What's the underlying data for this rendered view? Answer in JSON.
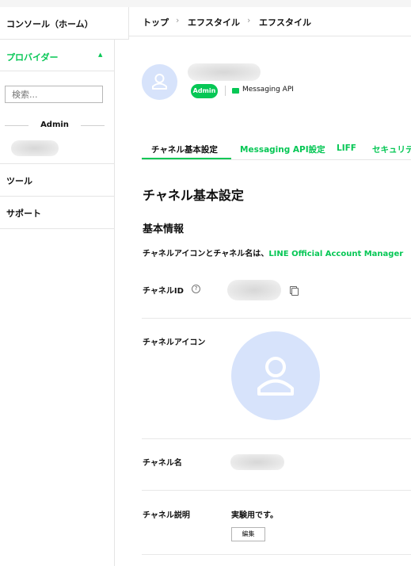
{
  "sidebar": {
    "home_label": "コンソール（ホーム）",
    "provider_label": "プロバイダー",
    "search_placeholder": "検索...",
    "admin_heading": "Admin",
    "items": [
      {
        "label": "ツール"
      },
      {
        "label": "サポート"
      }
    ]
  },
  "breadcrumb": [
    "トップ",
    "エフスタイル",
    "エフスタイル"
  ],
  "breadcrumb_sep": "›",
  "channel": {
    "role_badge": "Admin",
    "type_label": "Messaging API"
  },
  "tabs": [
    {
      "label": "チャネル基本設定",
      "active": true
    },
    {
      "label": "Messaging API設定",
      "active": false
    },
    {
      "label": "LIFF",
      "active": false
    },
    {
      "label": "セキュリテ",
      "active": false
    }
  ],
  "main": {
    "page_title": "チャネル基本設定",
    "section_title": "基本情報",
    "note_prefix": "チャネルアイコンとチャネル名は、",
    "note_link": "LINE Official Account Manager",
    "fields": {
      "channel_id_label": "チャネルID",
      "help_glyph": "?",
      "channel_icon_label": "チャネルアイコン",
      "channel_name_label": "チャネル名",
      "channel_desc_label": "チャネル説明",
      "channel_desc_value": "実験用です。",
      "edit_button": "編集"
    }
  },
  "colors": {
    "accent": "#06c755",
    "avatar_bg": "#d7e3fb",
    "avatar_fg": "#ffffff"
  },
  "icons": [
    "chevron-up-icon",
    "person-icon",
    "chat-icon",
    "help-icon",
    "copy-icon"
  ]
}
